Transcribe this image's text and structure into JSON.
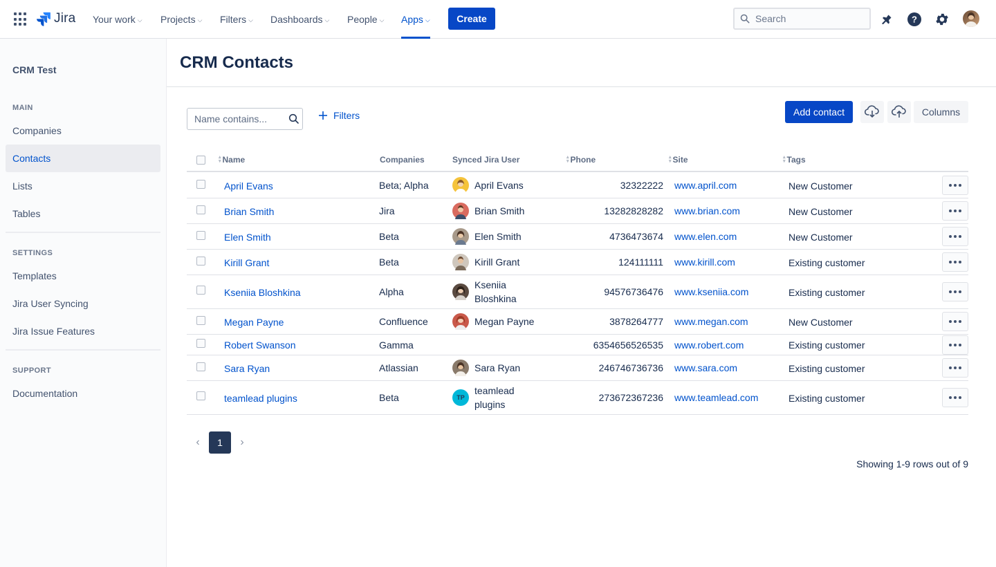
{
  "topnav": {
    "logo_text": "Jira",
    "items": [
      {
        "label": "Your work"
      },
      {
        "label": "Projects"
      },
      {
        "label": "Filters"
      },
      {
        "label": "Dashboards"
      },
      {
        "label": "People"
      },
      {
        "label": "Apps"
      }
    ],
    "active_item": "Apps",
    "create_label": "Create",
    "search_placeholder": "Search"
  },
  "sidebar": {
    "project": "CRM Test",
    "sections": [
      {
        "title": "MAIN",
        "items": [
          "Companies",
          "Contacts",
          "Lists",
          "Tables"
        ]
      },
      {
        "title": "SETTINGS",
        "items": [
          "Templates",
          "Jira User Syncing",
          "Jira Issue Features"
        ]
      },
      {
        "title": "SUPPORT",
        "items": [
          "Documentation"
        ]
      }
    ],
    "selected": "Contacts"
  },
  "page": {
    "title": "CRM Contacts",
    "name_filter_placeholder": "Name contains...",
    "filters_label": "Filters",
    "add_contact_label": "Add contact",
    "columns_label": "Columns"
  },
  "table": {
    "columns": [
      "Name",
      "Companies",
      "Synced Jira User",
      "Phone",
      "Site",
      "Tags"
    ],
    "rows": [
      {
        "name": "April Evans",
        "companies": "Beta; Alpha",
        "user_line1": "April Evans",
        "user_line2": "",
        "phone": "32322222",
        "site": "www.april.com",
        "tag": "New Customer"
      },
      {
        "name": "Brian Smith",
        "companies": "Jira",
        "user_line1": "Brian Smith",
        "user_line2": "",
        "phone": "13282828282",
        "site": "www.brian.com",
        "tag": "New Customer"
      },
      {
        "name": "Elen Smith",
        "companies": "Beta",
        "user_line1": "Elen Smith",
        "user_line2": "",
        "phone": "4736473674",
        "site": "www.elen.com",
        "tag": "New Customer"
      },
      {
        "name": "Kirill Grant",
        "companies": "Beta",
        "user_line1": "Kirill Grant",
        "user_line2": "",
        "phone": "124111111",
        "site": "www.kirill.com",
        "tag": "Existing customer"
      },
      {
        "name": "Kseniia Bloshkina",
        "companies": "Alpha",
        "user_line1": "Kseniia",
        "user_line2": "Bloshkina",
        "phone": "94576736476",
        "site": "www.kseniia.com",
        "tag": "Existing customer"
      },
      {
        "name": "Megan Payne",
        "companies": "Confluence",
        "user_line1": "Megan Payne",
        "user_line2": "",
        "phone": "3878264777",
        "site": "www.megan.com",
        "tag": "New Customer"
      },
      {
        "name": "Robert Swanson",
        "companies": "Gamma",
        "user_line1": "",
        "user_line2": "",
        "phone": "6354656526535",
        "site": "www.robert.com",
        "tag": "Existing customer"
      },
      {
        "name": "Sara Ryan",
        "companies": "Atlassian",
        "user_line1": "Sara Ryan",
        "user_line2": "",
        "phone": "246746736736",
        "site": "www.sara.com",
        "tag": "Existing customer"
      },
      {
        "name": "teamlead plugins",
        "companies": "Beta",
        "user_line1": "teamlead",
        "user_line2": "plugins",
        "user_initials": "TP",
        "phone": "273672367236",
        "site": "www.teamlead.com",
        "tag": "Existing customer"
      }
    ]
  },
  "pagination": {
    "current_page": "1",
    "summary": "Showing 1-9 rows out of 9"
  },
  "colors": {
    "brand": "#0052cc",
    "primary_button": "#0747c6",
    "page_active": "#253858"
  }
}
